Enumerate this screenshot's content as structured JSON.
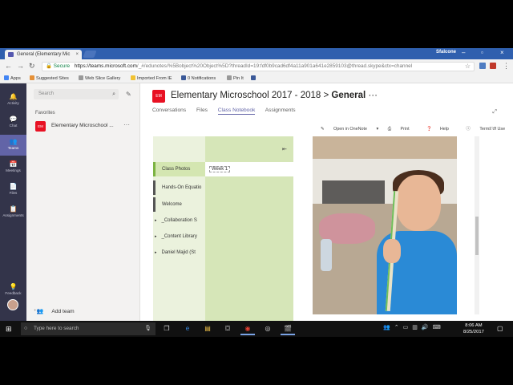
{
  "browser": {
    "tab_title": "General (Elementary Mic",
    "tab_close": "×",
    "user_label": "Sfalcone",
    "secure_label": "Secure",
    "url_host": "https://teams.microsoft.com",
    "url_rest": "/_#/edunotes/%5Bobject%20Object%5D?threadId=19:fdf0b9cad6df4a11a901a641e2859103@thread.skype&ctx=channel"
  },
  "bookmarks": [
    {
      "label": "Apps",
      "color": "#4285f4"
    },
    {
      "label": "Suggested Sites",
      "color": "#e69138"
    },
    {
      "label": "Web Slice Gallery",
      "color": "#999999"
    },
    {
      "label": "Imported From IE",
      "color": "#f1c232"
    },
    {
      "label": "0 Notifications",
      "color": "#3b5998"
    },
    {
      "label": "Pin It",
      "color": "#999999"
    }
  ],
  "rail": [
    {
      "label": "Activity",
      "icon": "bell-icon"
    },
    {
      "label": "Chat",
      "icon": "chat-icon"
    },
    {
      "label": "Teams",
      "icon": "teams-icon"
    },
    {
      "label": "Meetings",
      "icon": "calendar-icon"
    },
    {
      "label": "Files",
      "icon": "file-icon"
    },
    {
      "label": "Assignments",
      "icon": "assignment-icon"
    },
    {
      "label": "Feedback",
      "icon": "lightbulb-icon"
    }
  ],
  "sidebar": {
    "search_placeholder": "Search",
    "favorites_header": "Favorites",
    "team_badge": "EM",
    "team_name": "Elementary Microschool ...",
    "add_team": "Add team"
  },
  "header": {
    "badge": "EM",
    "team": "Elementary Microschool 2017 - 2018",
    "channel": "General",
    "tabs": [
      "Conversations",
      "Files",
      "Class Notebook",
      "Assignments"
    ],
    "active_tab": "Class Notebook"
  },
  "onenote": {
    "open_label": "Open in OneNote",
    "print_label": "Print",
    "help_label": "Help",
    "terms_label": "Terms of Use",
    "sections": [
      "Class Photos",
      "Hands-On Equatio",
      "Welcome"
    ],
    "section_groups": [
      "_Collaboration S",
      "_Content Library",
      "Daniel Majid (St"
    ],
    "page": "Week 1"
  },
  "taskbar": {
    "search_placeholder": "Type here to search",
    "time": "8:06 AM",
    "date": "8/25/2017"
  }
}
